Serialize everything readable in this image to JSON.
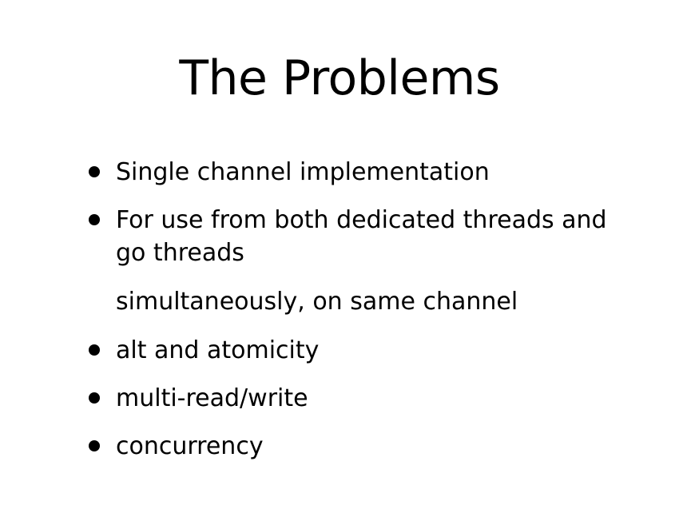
{
  "slide": {
    "title": "The Problems",
    "bullets": [
      {
        "line1": "Single channel implementation"
      },
      {
        "line1": "For use from both dedicated threads and",
        "line2": "go threads"
      },
      {
        "line1": "simultaneously, on same channel"
      },
      {
        "line1": "alt and atomicity"
      },
      {
        "line1": "multi-read/write"
      },
      {
        "line1": "concurrency"
      }
    ]
  }
}
